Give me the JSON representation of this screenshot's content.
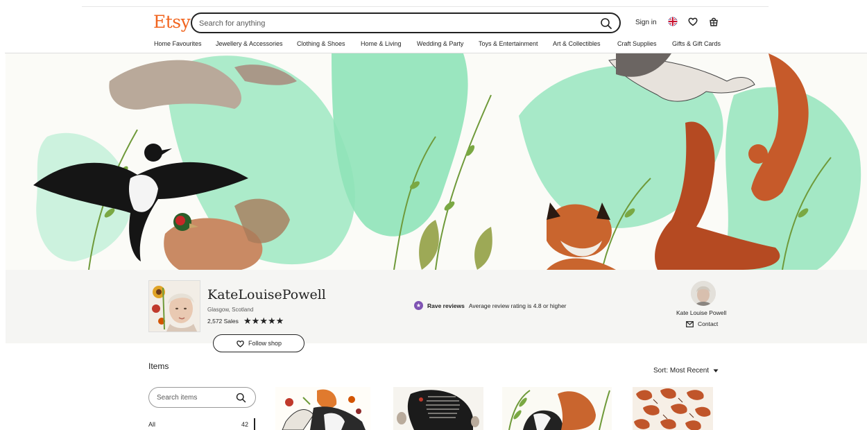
{
  "header": {
    "logo": "Etsy",
    "search_placeholder": "Search for anything",
    "sign_in": "Sign in",
    "icons": [
      "search-icon",
      "uk-flag-icon",
      "heart-icon",
      "basket-icon"
    ]
  },
  "nav": {
    "items": [
      "Home Favourites",
      "Jewellery & Accessories",
      "Clothing & Shoes",
      "Home & Living",
      "Wedding & Party",
      "Toys & Entertainment",
      "Art & Collectibles",
      "Craft Supplies",
      "Gifts & Gift Cards"
    ]
  },
  "shop": {
    "name": "KateLouisePowell",
    "location": "Glasgow, Scotland",
    "sales": "2,572 Sales",
    "rating_stars": 5,
    "follow_label": "Follow shop",
    "rave_title": "Rave reviews",
    "rave_text": "Average review rating is 4.8 or higher",
    "owner_name": "Kate Louise Powell",
    "contact_label": "Contact"
  },
  "items": {
    "title": "Items",
    "sort_label": "Sort: Most Recent",
    "search_placeholder": "Search items",
    "categories": [
      {
        "label": "All",
        "count": "42"
      }
    ]
  },
  "colors": {
    "brand": "#f1641e",
    "rave": "#7f54b3",
    "band": "#f5f5f3",
    "mint": "#8fe3b8"
  }
}
